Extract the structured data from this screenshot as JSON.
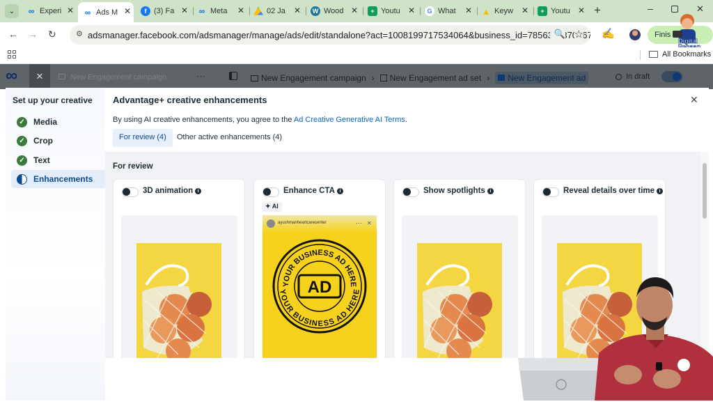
{
  "browser": {
    "tabs": [
      {
        "label": "Experi",
        "icon": "meta-icon"
      },
      {
        "label": "Ads M",
        "icon": "meta-icon"
      },
      {
        "label": "(3) Fa",
        "icon": "facebook-icon"
      },
      {
        "label": "Meta",
        "icon": "meta-icon"
      },
      {
        "label": "02 Ja",
        "icon": "drive-icon"
      },
      {
        "label": "Wood",
        "icon": "wordpress-icon"
      },
      {
        "label": "Youtu",
        "icon": "sheets-icon"
      },
      {
        "label": "What",
        "icon": "google-icon"
      },
      {
        "label": "Keyw",
        "icon": "google-ads-icon"
      },
      {
        "label": "Youtu",
        "icon": "sheets-icon"
      }
    ],
    "url": "adsmanager.facebook.com/adsmanager/manage/ads/edit/standalone?act=1008199717534064&business_id=785631137036741&gl...",
    "profile_button": "Finis",
    "all_bookmarks": "All Bookmarks",
    "logo_text_line1": "Digital",
    "logo_text_line2": "Pehaan"
  },
  "app_header": {
    "campaign_faded": "New Engagement campaign",
    "breadcrumb": [
      "New Engagement campaign",
      "New Engagement ad set",
      "New Engagement ad"
    ],
    "status": "In draft"
  },
  "sidebar": {
    "title": "Set up your creative",
    "steps": [
      {
        "label": "Media",
        "state": "done"
      },
      {
        "label": "Crop",
        "state": "done"
      },
      {
        "label": "Text",
        "state": "done"
      },
      {
        "label": "Enhancements",
        "state": "active"
      }
    ]
  },
  "main": {
    "title": "Advantage+ creative enhancements",
    "terms_prefix": "By using AI creative enhancements, you agree to the ",
    "terms_link": "Ad Creative Generative AI Terms",
    "terms_suffix": ".",
    "tabs": [
      {
        "label": "For review (4)",
        "active": true
      },
      {
        "label": "Other active enhancements (4)",
        "active": false
      }
    ],
    "section_heading": "For review",
    "cards": [
      {
        "title": "3D animation",
        "ai_badge": ""
      },
      {
        "title": "Enhance CTA",
        "ai_badge": "AI"
      },
      {
        "title": "Show spotlights",
        "ai_badge": ""
      },
      {
        "title": "Reveal details over time",
        "ai_badge": ""
      }
    ],
    "story_account": "ayushmanheartcarecenter",
    "ad_ring_top": "YOUR BUSINESS AD HERE",
    "ad_ring_bottom": "YOUR BUSINESS AD HERE",
    "ad_center": "AD"
  },
  "colors": {
    "tabstrip": "#cfe3c9",
    "link": "#0a66c2",
    "step_check": "#3b7a3a",
    "tab_active_bg": "#e8f0fb",
    "ad_yellow": "#f6d21c"
  }
}
